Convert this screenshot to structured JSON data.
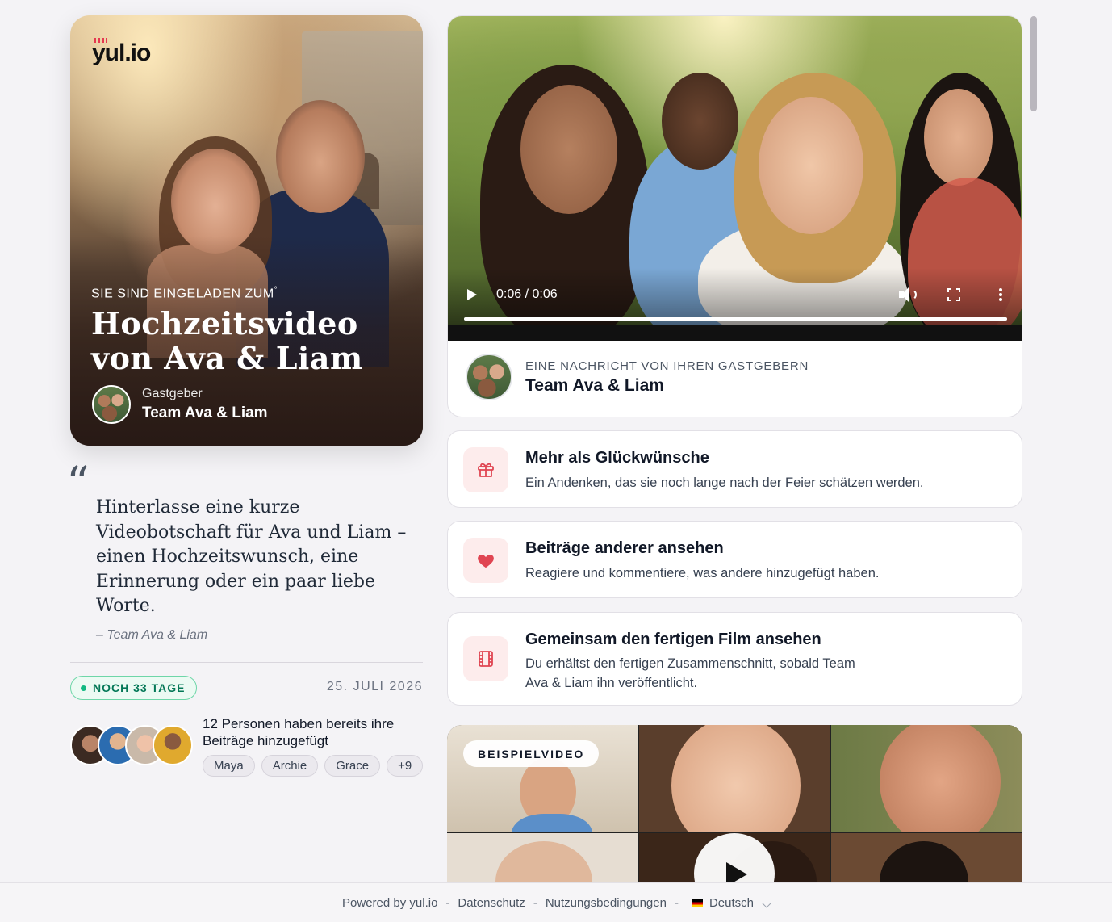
{
  "brand": {
    "logo_text": "yul.io",
    "accent": "#e53950"
  },
  "hero": {
    "eyebrow": "SIE SIND EINGELADEN ZUM",
    "title_line1": "Hochzeitsvideo",
    "title_line2": "von Ava & Liam",
    "host_label": "Gastgeber",
    "host_name": "Team Ava & Liam"
  },
  "quote": {
    "mark": "“",
    "text": "Hinterlasse eine kurze Videobotschaft für Ava und Liam – einen Hochzeitswunsch, eine Erinnerung oder ein paar liebe Worte.",
    "author": "– Team Ava & Liam"
  },
  "status": {
    "days_left": "NOCH 33 TAGE",
    "date": "25. JULI 2026",
    "accent": "#10b981"
  },
  "contributors": {
    "summary": "12 Personen haben bereits ihre Beiträge hinzugefügt",
    "names": [
      "Maya",
      "Archie",
      "Grace",
      "+9"
    ]
  },
  "video": {
    "time": "0:06 / 0:06",
    "progress": 1.0,
    "host_eyebrow": "EINE NACHRICHT VON IHREN GASTGEBERN",
    "host_name": "Team Ava & Liam"
  },
  "features": [
    {
      "icon": "gift-icon",
      "title": "Mehr als Glückwünsche",
      "desc": "Ein Andenken, das sie noch lange nach der Feier schätzen werden."
    },
    {
      "icon": "heart-icon",
      "title": "Beiträge anderer ansehen",
      "desc": "Reagiere und kommentiere, was andere hinzugefügt haben."
    },
    {
      "icon": "film-icon",
      "title": "Gemeinsam den fertigen Film ansehen",
      "desc": "Du erhältst den fertigen Zusammenschnitt, sobald Team Ava & Liam ihn veröffentlicht."
    }
  ],
  "sample": {
    "badge": "BEISPIELVIDEO"
  },
  "footer": {
    "powered": "Powered by yul.io",
    "privacy": "Datenschutz",
    "terms": "Nutzungsbedingungen",
    "language": "Deutsch",
    "separator": "-"
  }
}
